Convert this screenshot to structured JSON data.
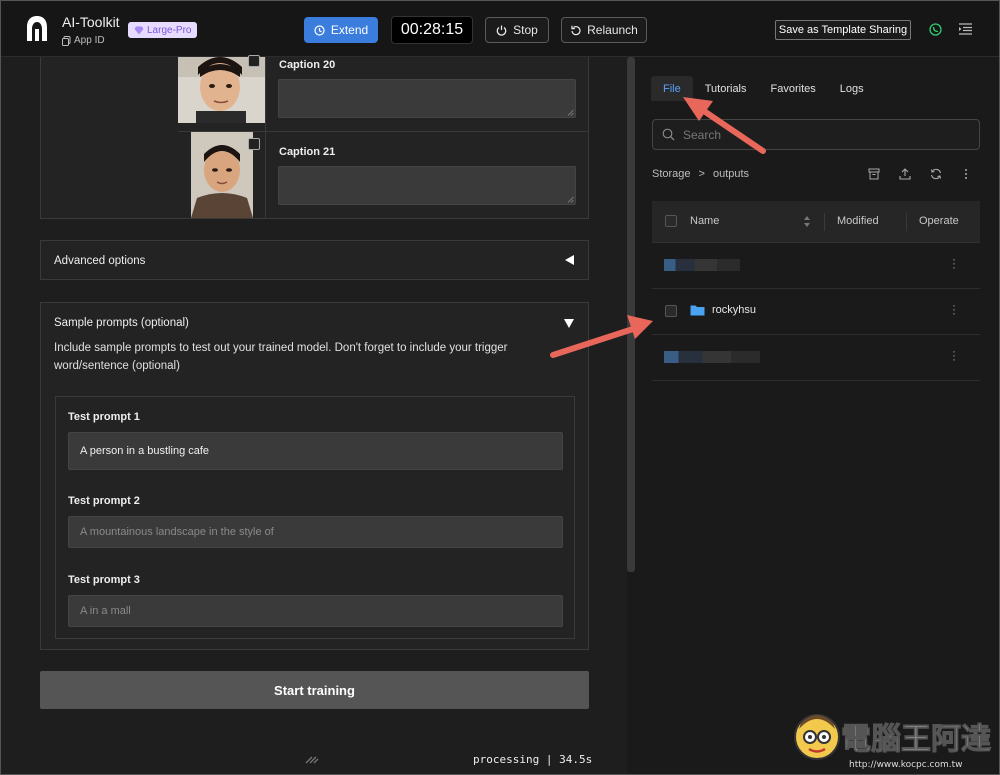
{
  "header": {
    "app_title": "AI-Toolkit",
    "app_id_label": "App ID",
    "plan_badge": "Large-Pro",
    "extend_label": "Extend",
    "timer": "00:28:15",
    "stop_label": "Stop",
    "relaunch_label": "Relaunch",
    "template_label": "Save as Template Sharing"
  },
  "captions": [
    {
      "label": "Caption 20",
      "value": ""
    },
    {
      "label": "Caption 21",
      "value": ""
    }
  ],
  "advanced": {
    "title": "Advanced options"
  },
  "sample": {
    "title": "Sample prompts (optional)",
    "description": "Include sample prompts to test out your trained model. Don't forget to include your trigger word/sentence (optional)",
    "prompts": [
      {
        "label": "Test prompt 1",
        "value": "A person in a bustling cafe",
        "placeholder": ""
      },
      {
        "label": "Test prompt 2",
        "value": "",
        "placeholder": "A mountainous landscape in the style of"
      },
      {
        "label": "Test prompt 3",
        "value": "",
        "placeholder": "A  in a mall"
      }
    ]
  },
  "start_button": "Start training",
  "status": "processing | 34.5s",
  "right": {
    "tabs": [
      "File",
      "Tutorials",
      "Favorites",
      "Logs"
    ],
    "active_tab": "File",
    "search_placeholder": "Search",
    "breadcrumb": [
      "Storage",
      ">",
      "outputs"
    ],
    "columns": [
      "Name",
      "Modified",
      "Operate"
    ],
    "rows": [
      {
        "name": ""
      },
      {
        "name": "rockyhsu"
      },
      {
        "name": ""
      }
    ]
  },
  "watermark": {
    "text": "電腦王阿達",
    "url": "http://www.kocpc.com.tw"
  },
  "colors": {
    "accent": "#3b7ddc",
    "tab_active": "#5aa0ff",
    "annotation_arrow": "#e8665a",
    "folder": "#4aa3f0"
  }
}
